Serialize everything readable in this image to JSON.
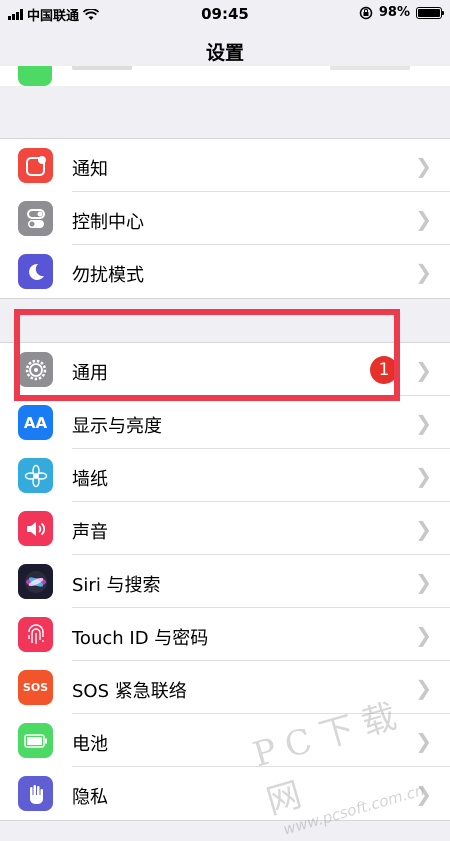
{
  "status_bar": {
    "carrier": "中国联通",
    "time": "09:45",
    "battery_percent": "98%",
    "battery_level": 0.98,
    "icons": [
      "signal-icon",
      "wifi-icon",
      "orientation-lock-icon",
      "battery-icon"
    ]
  },
  "nav": {
    "title": "设置"
  },
  "group1": {
    "items": [
      {
        "label": "通知",
        "icon": "notifications-icon",
        "color": "#f0483e"
      },
      {
        "label": "控制中心",
        "icon": "control-center-icon",
        "color": "#8e8e93"
      },
      {
        "label": "勿扰模式",
        "icon": "moon-icon",
        "color": "#5856d6"
      }
    ]
  },
  "group2": {
    "items": [
      {
        "label": "通用",
        "icon": "gear-icon",
        "color": "#8e8e93",
        "badge": "1"
      },
      {
        "label": "显示与亮度",
        "icon": "display-aa-icon",
        "color": "#1a7cf5",
        "icon_text": "AA"
      },
      {
        "label": "墙纸",
        "icon": "wallpaper-flower-icon",
        "color": "#35aadc"
      },
      {
        "label": "声音",
        "icon": "speaker-icon",
        "color": "#f2365a"
      },
      {
        "label": "Siri 与搜索",
        "icon": "siri-icon",
        "color": "#1c1c2e"
      },
      {
        "label": "Touch ID 与密码",
        "icon": "fingerprint-icon",
        "color": "#f2365a"
      },
      {
        "label": "SOS 紧急联络",
        "icon": "sos-icon",
        "color": "#f2552c",
        "icon_text": "SOS"
      },
      {
        "label": "电池",
        "icon": "battery-icon",
        "color": "#4cd964"
      },
      {
        "label": "隐私",
        "icon": "privacy-hand-icon",
        "color": "#5f5fd3"
      }
    ]
  },
  "watermark": {
    "line1": "PC下载网",
    "line2": "www.pcsoft.com.cn"
  },
  "colors": {
    "highlight": "#ee3a4d",
    "background": "#efeff4",
    "badge": "#e8302b"
  }
}
